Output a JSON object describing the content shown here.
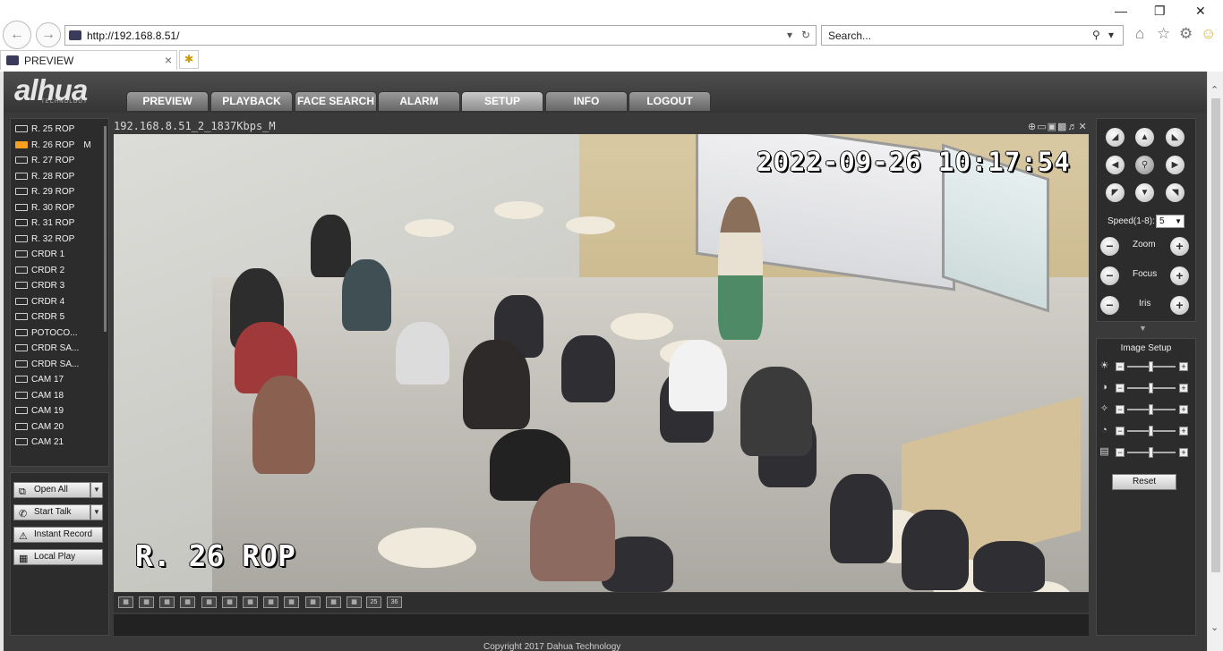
{
  "browser": {
    "url": "http://192.168.8.51/",
    "search_placeholder": "Search...",
    "tab_title": "PREVIEW"
  },
  "app": {
    "logo": "alhua",
    "logo_sub": "TECHNOLOGY",
    "menu": [
      "PREVIEW",
      "PLAYBACK",
      "FACE SEARCH",
      "ALARM",
      "SETUP",
      "INFO",
      "LOGOUT"
    ],
    "active_menu": "SETUP"
  },
  "channels": [
    {
      "label": "R. 25 ROP",
      "active": false
    },
    {
      "label": "R. 26 ROP",
      "active": true,
      "stream": "M"
    },
    {
      "label": "R. 27 ROP",
      "active": false
    },
    {
      "label": "R. 28 ROP",
      "active": false
    },
    {
      "label": "R. 29 ROP",
      "active": false
    },
    {
      "label": "R. 30 ROP",
      "active": false
    },
    {
      "label": "R. 31 ROP",
      "active": false
    },
    {
      "label": "R. 32 ROP",
      "active": false
    },
    {
      "label": "CRDR 1",
      "active": false
    },
    {
      "label": "CRDR 2",
      "active": false
    },
    {
      "label": "CRDR 3",
      "active": false
    },
    {
      "label": "CRDR 4",
      "active": false
    },
    {
      "label": "CRDR 5",
      "active": false
    },
    {
      "label": "POTOCO...",
      "active": false
    },
    {
      "label": "CRDR SA...",
      "active": false
    },
    {
      "label": "CRDR SA...",
      "active": false
    },
    {
      "label": "CAM 17",
      "active": false
    },
    {
      "label": "CAM 18",
      "active": false
    },
    {
      "label": "CAM 19",
      "active": false
    },
    {
      "label": "CAM 20",
      "active": false
    },
    {
      "label": "CAM 21",
      "active": false
    }
  ],
  "controls": {
    "open_all": "Open All",
    "start_talk": "Start Talk",
    "instant_record": "Instant Record",
    "local_play": "Local Play"
  },
  "video": {
    "stream_title": "192.168.8.51_2_1837Kbps_M",
    "osd_datetime": "2022-09-26 10:17:54",
    "osd_channel": "R. 26 ROP"
  },
  "layout_buttons": [
    "",
    "",
    "",
    "",
    "",
    "",
    "",
    "",
    "",
    "",
    "",
    "",
    "25",
    "36"
  ],
  "footer": "Copyright 2017 Dahua Technology",
  "ptz": {
    "speed_label": "Speed(1-8):",
    "speed_value": "5",
    "zoom": "Zoom",
    "focus": "Focus",
    "iris": "Iris"
  },
  "image_setup": {
    "title": "Image Setup",
    "reset": "Reset",
    "sliders": [
      {
        "icon": "brightness-icon",
        "level": 0.5
      },
      {
        "icon": "contrast-icon",
        "level": 0.5
      },
      {
        "icon": "saturation-icon",
        "level": 0.5
      },
      {
        "icon": "gain-icon",
        "level": 0.5
      },
      {
        "icon": "sharpness-icon",
        "level": 0.5
      }
    ]
  },
  "colors": {
    "active_channel": "#f7a020",
    "panel_bg": "#2c2c2c",
    "app_bg": "#3a3a3a"
  }
}
